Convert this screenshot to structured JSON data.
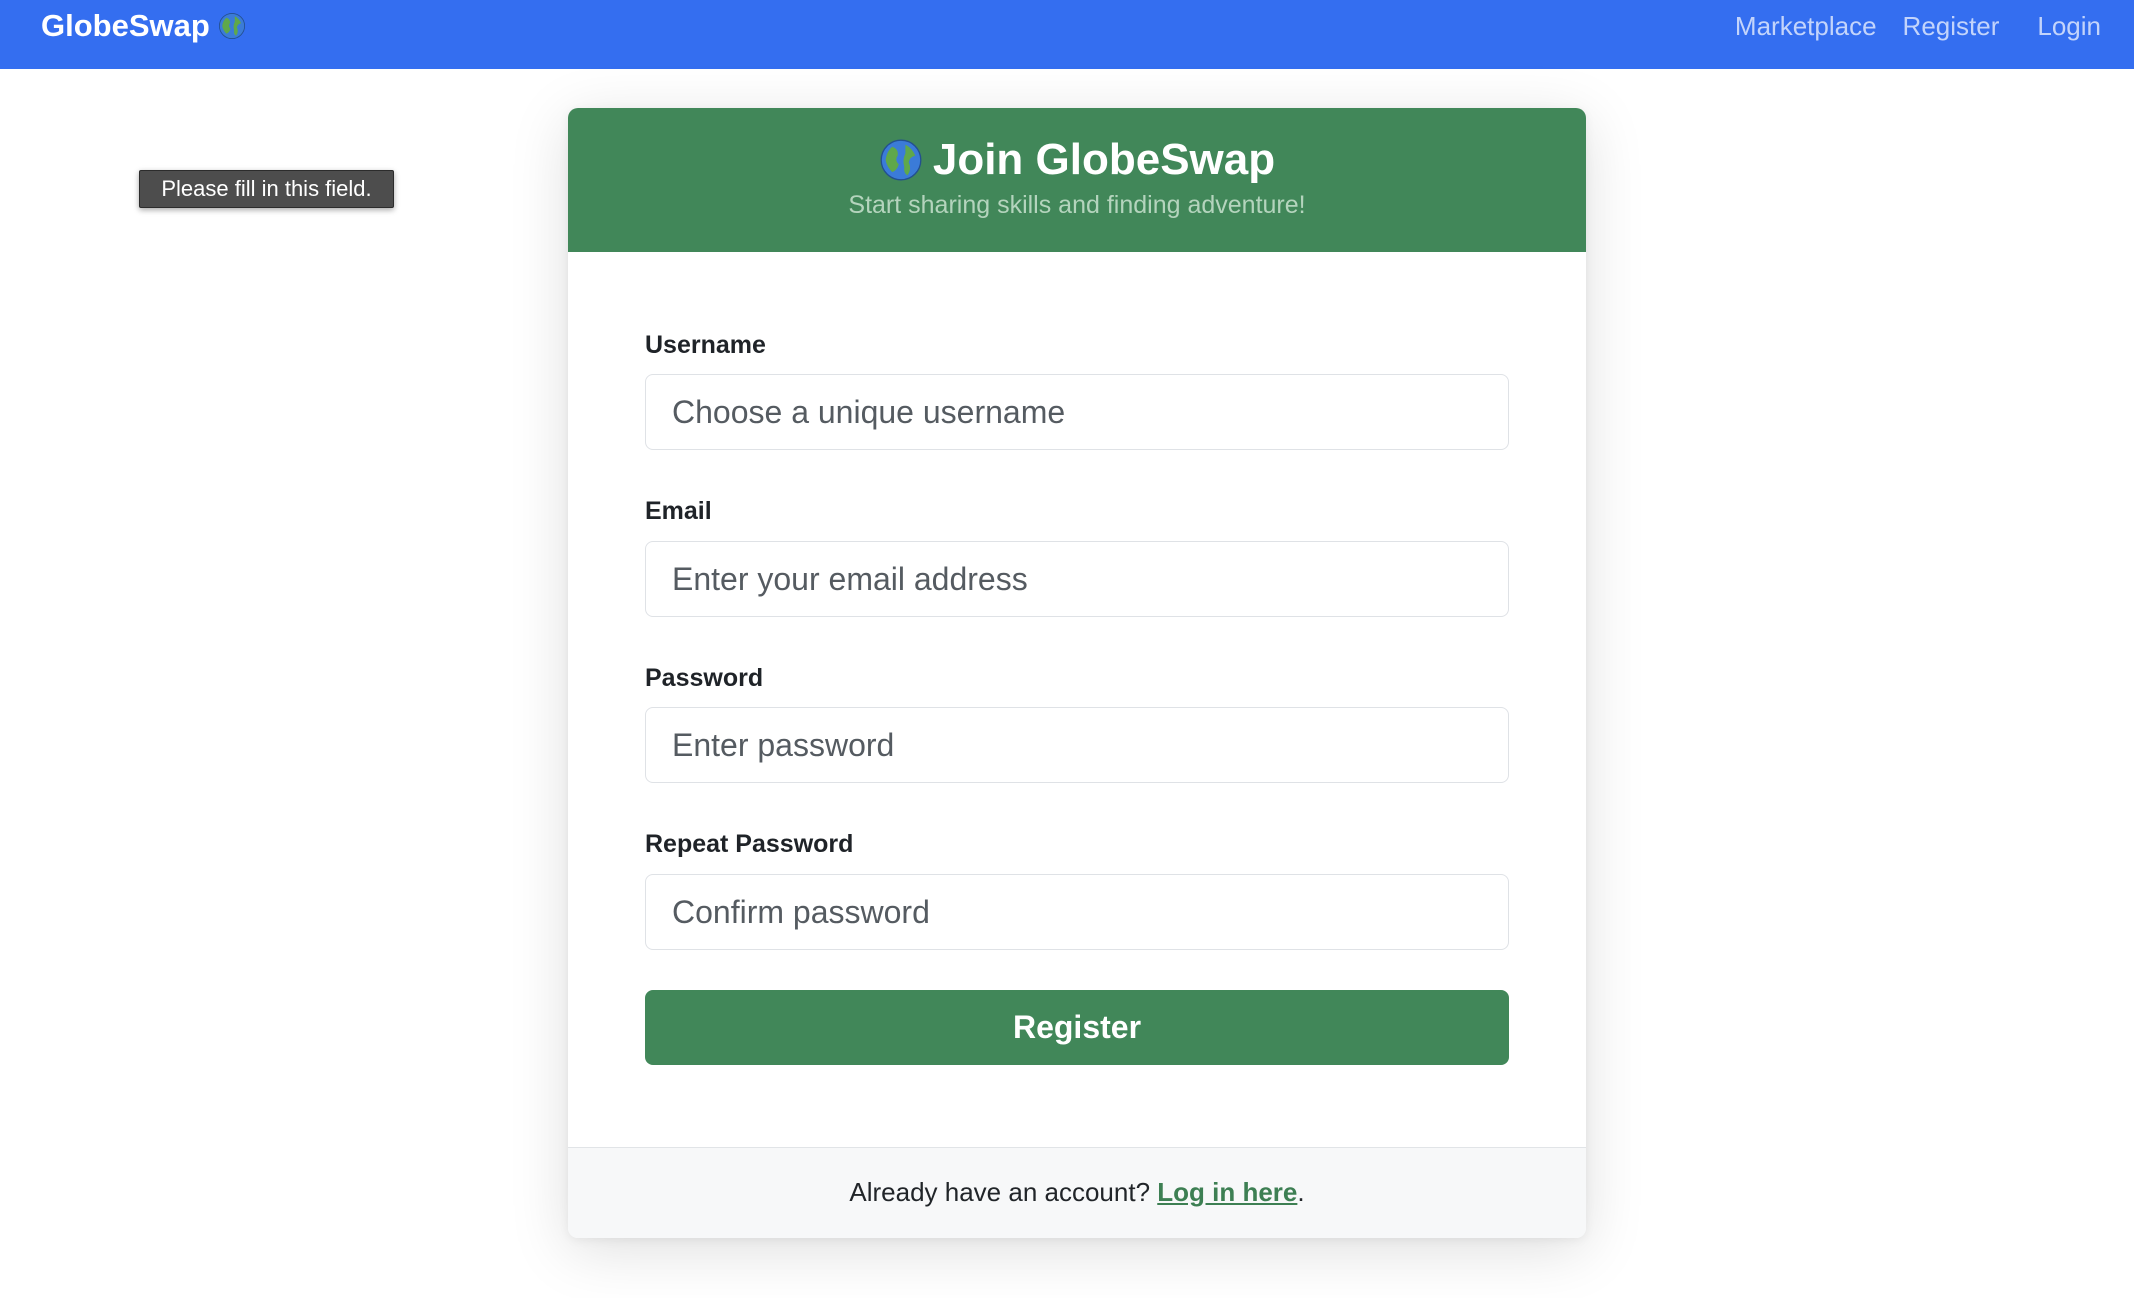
{
  "navbar": {
    "brand": "GlobeSwap",
    "brand_icon": "globe-icon",
    "background": "#346ef0",
    "links": [
      {
        "label": "Marketplace"
      },
      {
        "label": "Register"
      },
      {
        "label": "Login"
      }
    ]
  },
  "tooltip": {
    "text": "Please fill in this field."
  },
  "card": {
    "title": "Join GlobeSwap",
    "title_icon": "globe-icon",
    "subtitle": "Start sharing skills and finding adventure!",
    "accent": "#418759",
    "fields": {
      "username": {
        "label": "Username",
        "placeholder": "Choose a unique username",
        "value": ""
      },
      "email": {
        "label": "Email",
        "placeholder": "Enter your email address",
        "value": ""
      },
      "password": {
        "label": "Password",
        "placeholder": "Enter password",
        "value": ""
      },
      "repeat_password": {
        "label": "Repeat Password",
        "placeholder": "Confirm password",
        "value": ""
      }
    },
    "submit_label": "Register",
    "footer": {
      "prefix": "Already have an account?",
      "link": "Log in here",
      "suffix": "."
    }
  }
}
